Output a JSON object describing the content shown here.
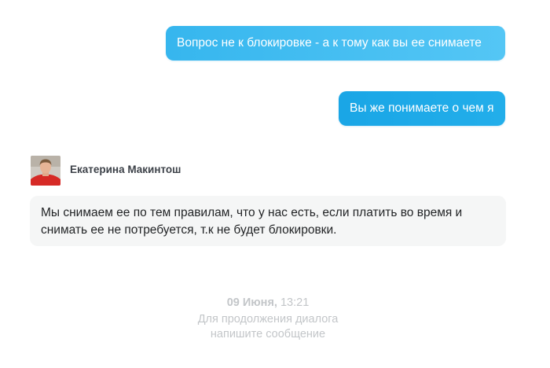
{
  "chat": {
    "outgoing": [
      {
        "text": "Вопрос не к блокировке - а к тому как вы ее снимаете"
      },
      {
        "text": "Вы же понимаете о чем я"
      }
    ],
    "incoming": {
      "sender_name": "Екатерина Макинтош",
      "avatar": "user-photo",
      "text": "Мы снимаем ее по тем правилам, что у нас есть, если платить во время и снимать ее не потребуется, т.к не будет блокировки."
    },
    "footer": {
      "date": "09 Июня,",
      "time": "13:21",
      "line1": "Для продолжения диалога",
      "line2": "напишите сообщение"
    }
  },
  "colors": {
    "outgoing_bubble_light": "#45bff2",
    "outgoing_bubble": "#1ea9e8",
    "incoming_bubble": "#f5f6f6",
    "sender_name": "#3c4148",
    "muted_text": "#c3c6c9"
  }
}
